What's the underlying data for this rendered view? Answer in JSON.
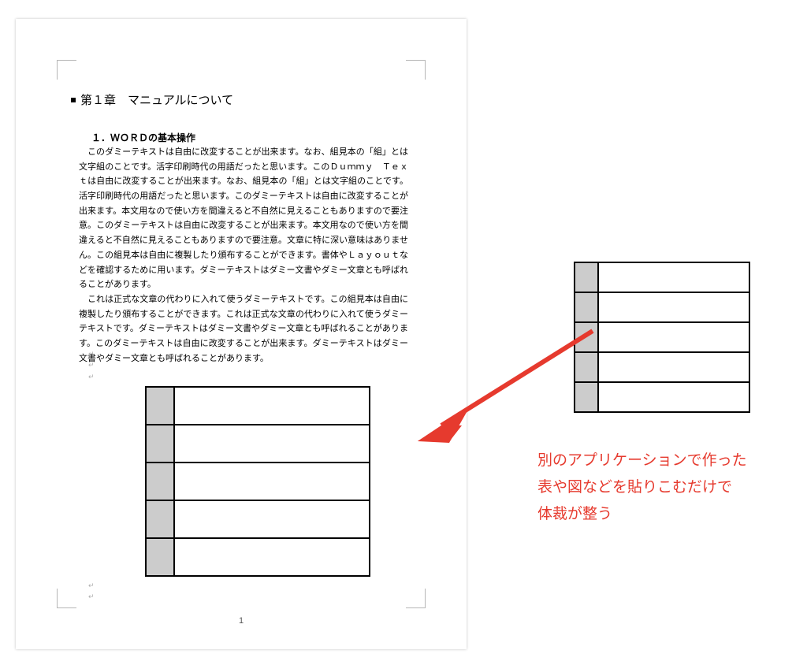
{
  "document": {
    "chapter_title": "第１章　マニュアルについて",
    "section_title": "１．ＷＯＲＤの基本操作",
    "paragraphs": [
      "このダミーテキストは自由に改変することが出来ます。なお、組見本の「組」とは文字組のことです。活字印刷時代の用語だったと思います。このＤｕｍｍｙ　Ｔｅｘｔは自由に改変することが出来ます。なお、組見本の「組」とは文字組のことです。活字印刷時代の用語だったと思います。このダミーテキストは自由に改変することが出来ます。本文用なので使い方を間違えると不自然に見えることもありますので要注意。このダミーテキストは自由に改変することが出来ます。本文用なので使い方を間違えると不自然に見えることもありますので要注意。文章に特に深い意味はありません。この組見本は自由に複製したり頒布することができます。書体やＬａｙｏｕｔなどを確認するために用います。ダミーテキストはダミー文書やダミー文章とも呼ばれることがあります。",
      "これは正式な文章の代わりに入れて使うダミーテキストです。この組見本は自由に複製したり頒布することができます。これは正式な文章の代わりに入れて使うダミーテキストです。ダミーテキストはダミー文書やダミー文章とも呼ばれることがあります。このダミーテキストは自由に改変することが出来ます。ダミーテキストはダミー文書やダミー文章とも呼ばれることがあります。"
    ],
    "page_number": "1",
    "para_mark": "↵"
  },
  "caption": {
    "line1": "別のアプリケーションで作った",
    "line2": "表や図などを貼りこむだけで",
    "line3": "体裁が整う"
  },
  "colors": {
    "accent_red": "#e63a2e",
    "table_header_fill": "#cccccc"
  },
  "tables": {
    "embedded": {
      "rows": 5,
      "cols": 2
    },
    "source": {
      "rows": 5,
      "cols": 2
    }
  }
}
